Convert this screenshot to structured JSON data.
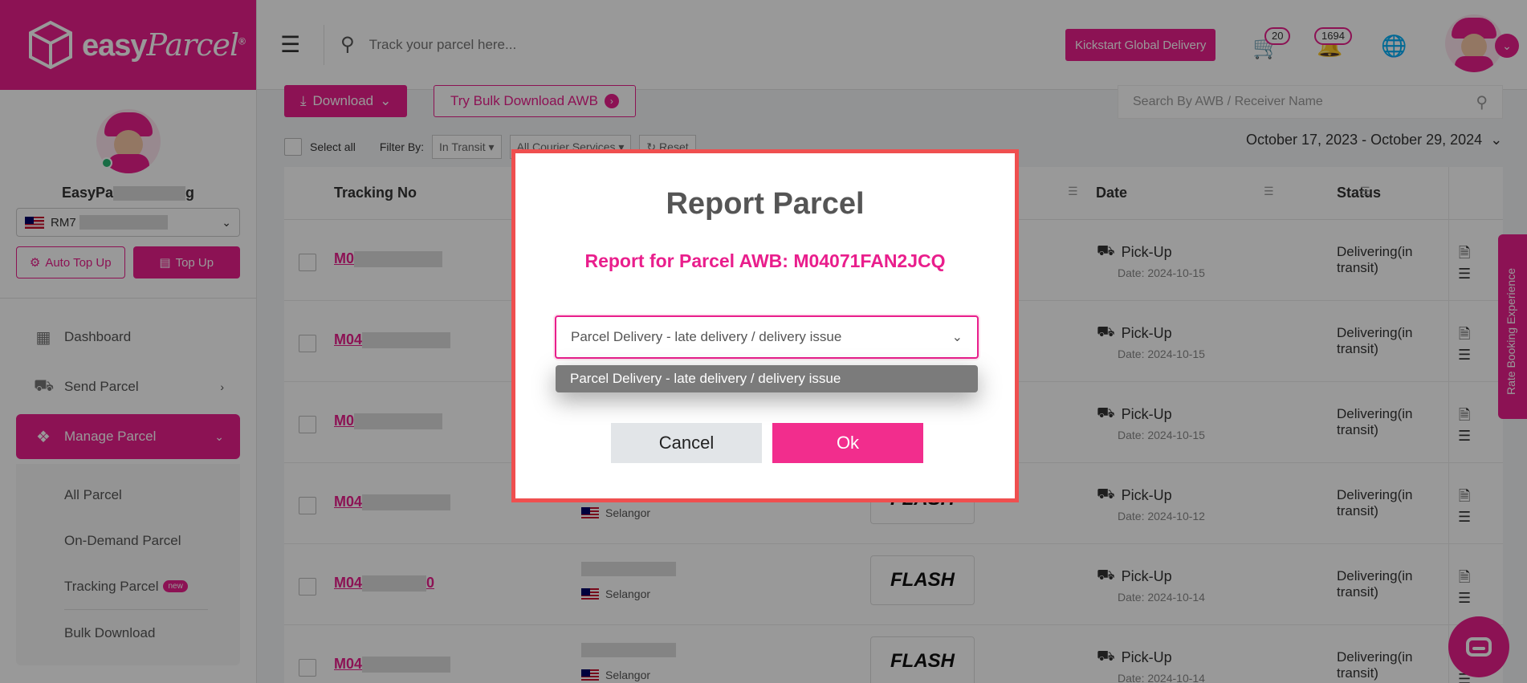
{
  "brand": {
    "logo_text": "easyParcel",
    "logo_bold": "easy",
    "logo_italic": "Parcel",
    "primary_color": "#e91e8c"
  },
  "topbar": {
    "track_placeholder": "Track your parcel here...",
    "kickstart_label": "Kickstart Global Delivery",
    "cart_count": "20",
    "notification_count": "1694"
  },
  "sidebar": {
    "profile_name_visible": "EasyPa",
    "profile_name_tail": "g",
    "balance_prefix": "RM7",
    "auto_topup_label": "Auto Top Up",
    "topup_label": "Top Up",
    "nav": [
      {
        "label": "Dashboard",
        "icon": "dashboard-icon"
      },
      {
        "label": "Send Parcel",
        "icon": "truck-icon"
      },
      {
        "label": "Manage Parcel",
        "icon": "boxes-icon"
      }
    ],
    "subnav": [
      {
        "label": "All Parcel"
      },
      {
        "label": "On-Demand Parcel"
      },
      {
        "label": "Tracking Parcel",
        "badge": "new"
      },
      {
        "label": "Bulk Download"
      }
    ]
  },
  "toolbar": {
    "download_label": "Download",
    "bulk_label": "Try Bulk Download AWB",
    "search_placeholder": "Search By AWB / Receiver Name",
    "select_all_label": "Select all",
    "filter_by_label": "Filter By:",
    "filter_status": "In Transit",
    "filter_courier": "All Courier Services",
    "reset_label": "Reset",
    "date_range": "October 17, 2023 - October 29, 2024"
  },
  "table": {
    "headers": {
      "tracking": "Tracking No",
      "date": "Date",
      "status": "Status"
    },
    "rows": [
      {
        "track_prefix": "M0",
        "state": "",
        "courier": "",
        "date_label": "Pick-Up",
        "date_value": "Date: 2024-10-15",
        "status": "Delivering(in transit)"
      },
      {
        "track_prefix": "M04",
        "state": "",
        "courier": "",
        "date_label": "Pick-Up",
        "date_value": "Date: 2024-10-15",
        "status": "Delivering(in transit)"
      },
      {
        "track_prefix": "M0",
        "state": "",
        "courier": "",
        "date_label": "Pick-Up",
        "date_value": "Date: 2024-10-15",
        "status": "Delivering(in transit)"
      },
      {
        "track_prefix": "M04",
        "state": "Selangor",
        "courier": "FLASH",
        "date_label": "Pick-Up",
        "date_value": "Date: 2024-10-12",
        "status": "Delivering(in transit)"
      },
      {
        "track_prefix": "M04",
        "track_suffix": "0",
        "state": "Selangor",
        "courier": "FLASH",
        "date_label": "Pick-Up",
        "date_value": "Date: 2024-10-14",
        "status": "Delivering(in transit)"
      },
      {
        "track_prefix": "M04",
        "state": "Selangor",
        "courier": "FLASH",
        "date_label": "Pick-Up",
        "date_value": "Date: 2024-10-14",
        "status": "Delivering(in transit)"
      }
    ]
  },
  "modal": {
    "title": "Report Parcel",
    "subtitle": "Report for Parcel AWB: M04071FAN2JCQ",
    "selected_reason": "Parcel Delivery - late delivery / delivery issue",
    "options": [
      "Parcel Delivery - late delivery / delivery issue"
    ],
    "cancel_label": "Cancel",
    "ok_label": "Ok"
  },
  "widgets": {
    "rate_tab_label": "Rate Booking Experience"
  }
}
